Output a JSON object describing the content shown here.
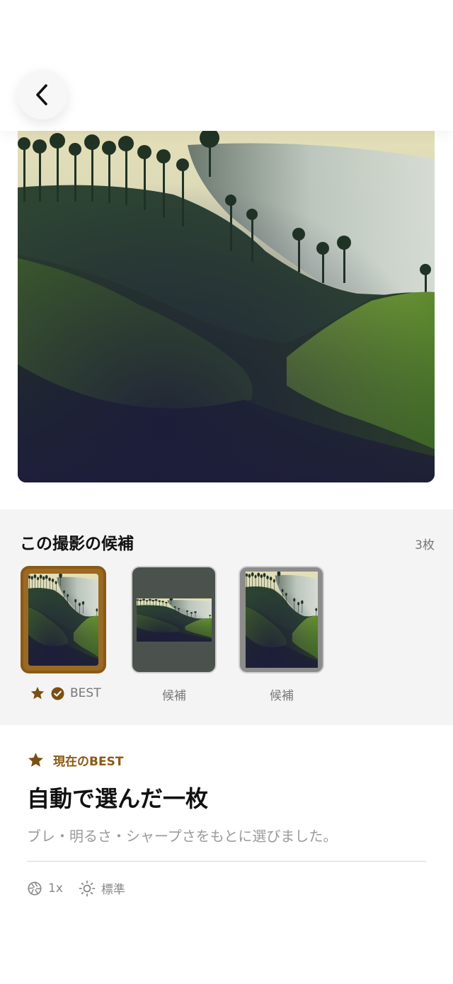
{
  "nav": {
    "back_icon": "chevron-left-icon"
  },
  "candidates": {
    "title": "この撮影の候補",
    "count": "3枚",
    "items": [
      {
        "label": "BEST",
        "selected": true,
        "icons": [
          "star-icon",
          "check-circle-icon"
        ]
      },
      {
        "label": "候補",
        "selected": false
      },
      {
        "label": "候補",
        "selected": false
      }
    ]
  },
  "current": {
    "tag": "現在のBEST",
    "tag_icon": "star-icon",
    "title": "自動で選んだ一枚",
    "description": "ブレ・明るさ・シャープさをもとに選びました。",
    "zoom": "1x",
    "zoom_icon": "aperture-icon",
    "exposure": "標準",
    "exposure_icon": "sun-icon"
  },
  "colors": {
    "accent": "#8a5a14",
    "muted": "#888888",
    "panel": "#f4f4f4"
  }
}
